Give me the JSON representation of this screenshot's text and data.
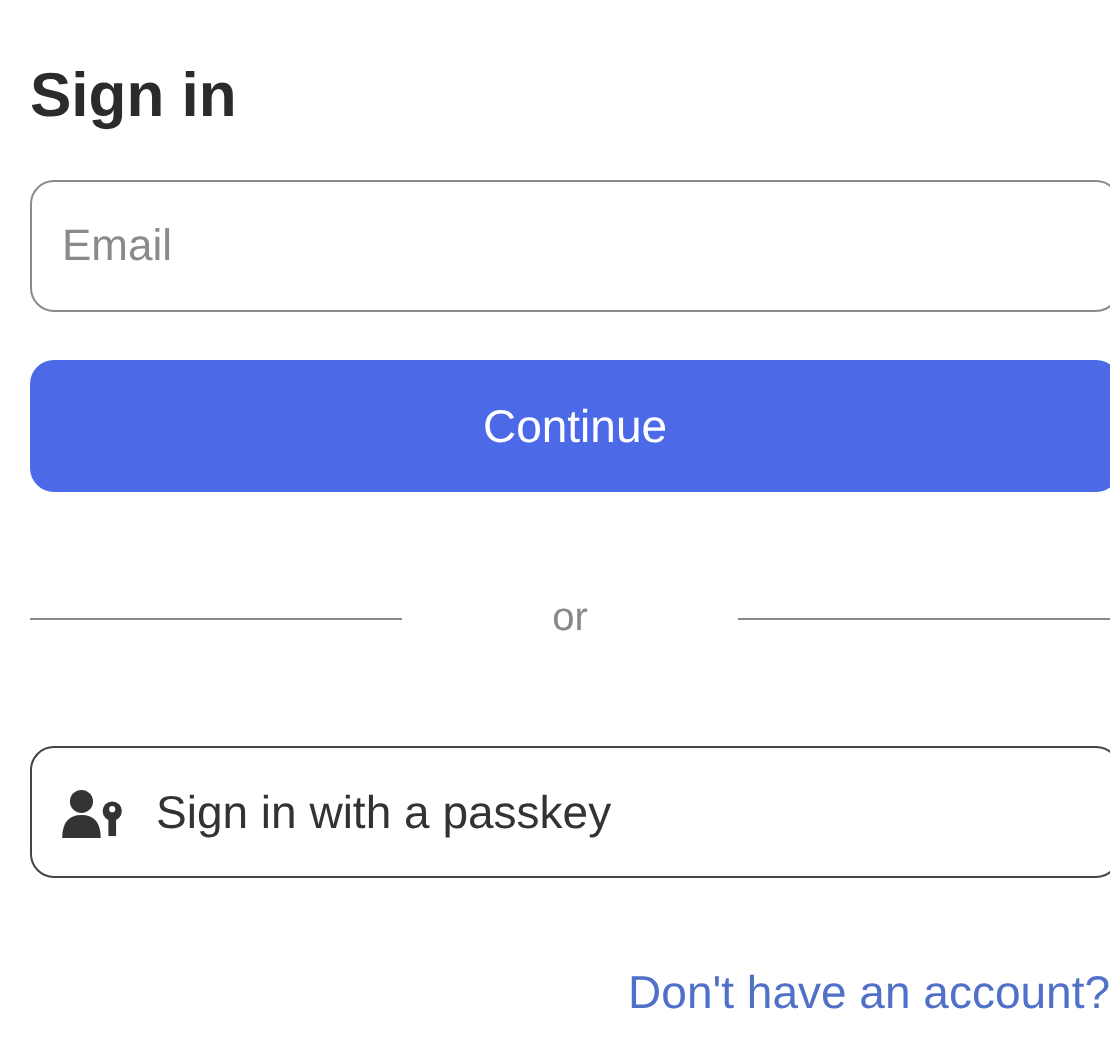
{
  "title": "Sign in",
  "email": {
    "placeholder": "Email"
  },
  "continue_button": "Continue",
  "divider": "or",
  "passkey_button": "Sign in with a passkey",
  "signup_link": "Don't have an account?"
}
